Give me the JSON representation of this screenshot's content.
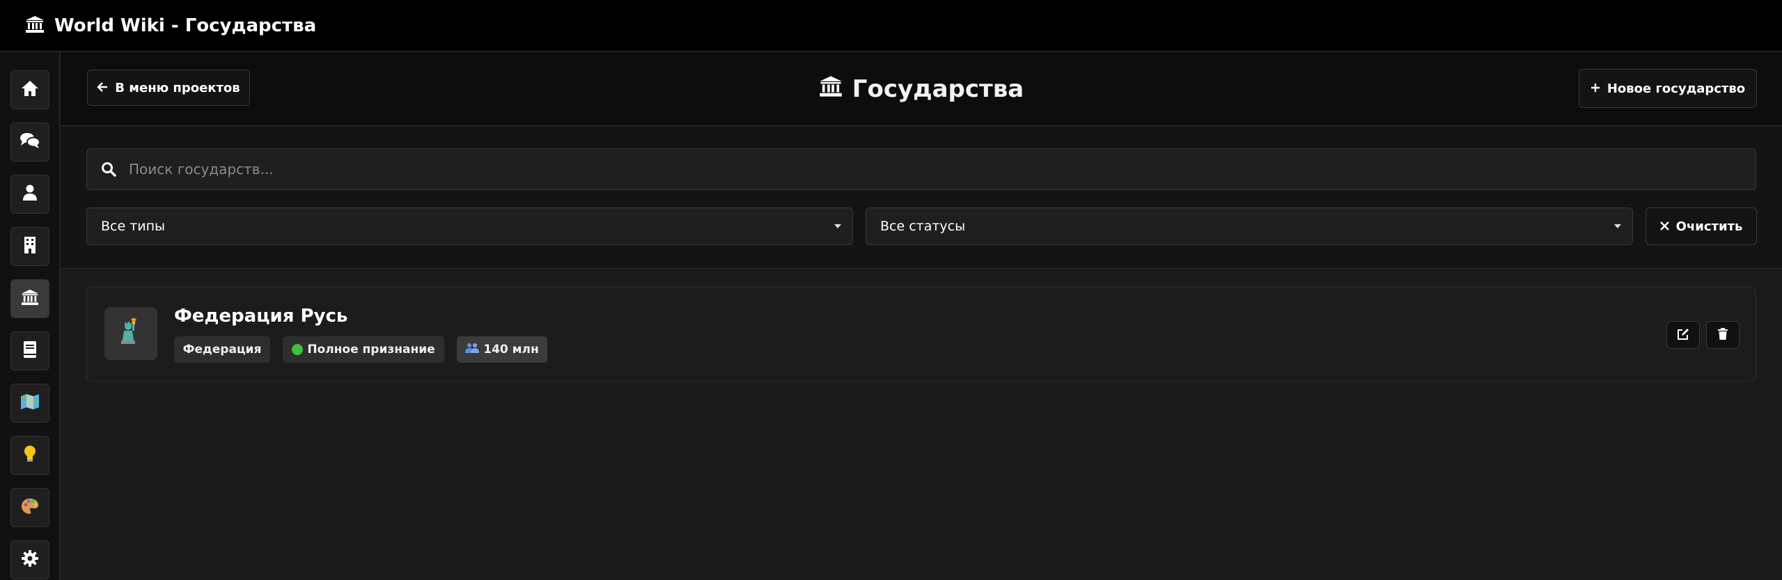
{
  "app": {
    "title": "World Wiki - Государства",
    "title_icon": "landmark-icon"
  },
  "sidebar": {
    "items": [
      {
        "name": "home",
        "icon": "home-icon",
        "active": false
      },
      {
        "name": "chats",
        "icon": "comments-icon",
        "active": false
      },
      {
        "name": "characters",
        "icon": "user-icon",
        "active": false
      },
      {
        "name": "buildings",
        "icon": "building-icon",
        "active": false
      },
      {
        "name": "states",
        "icon": "landmark-icon",
        "active": true
      },
      {
        "name": "books",
        "icon": "book-icon",
        "active": false
      },
      {
        "name": "maps",
        "icon": "map-icon",
        "active": false
      },
      {
        "name": "ideas",
        "icon": "lightbulb-icon",
        "active": false
      },
      {
        "name": "art",
        "icon": "palette-icon",
        "active": false
      },
      {
        "name": "settings",
        "icon": "gear-icon",
        "active": false
      }
    ]
  },
  "header": {
    "back_label": "В меню проектов",
    "page_title": "Государства",
    "new_label": "Новое государство"
  },
  "filters": {
    "search_placeholder": "Поиск государств...",
    "type_select": "Все типы",
    "status_select": "Все статусы",
    "clear_label": "Очистить"
  },
  "states": [
    {
      "name": "Федерация Русь",
      "avatar": "statue-of-liberty-icon",
      "type": "Федерация",
      "status": "Полное признание",
      "status_color": "#3fbf3f",
      "population": "140 млн"
    }
  ]
}
